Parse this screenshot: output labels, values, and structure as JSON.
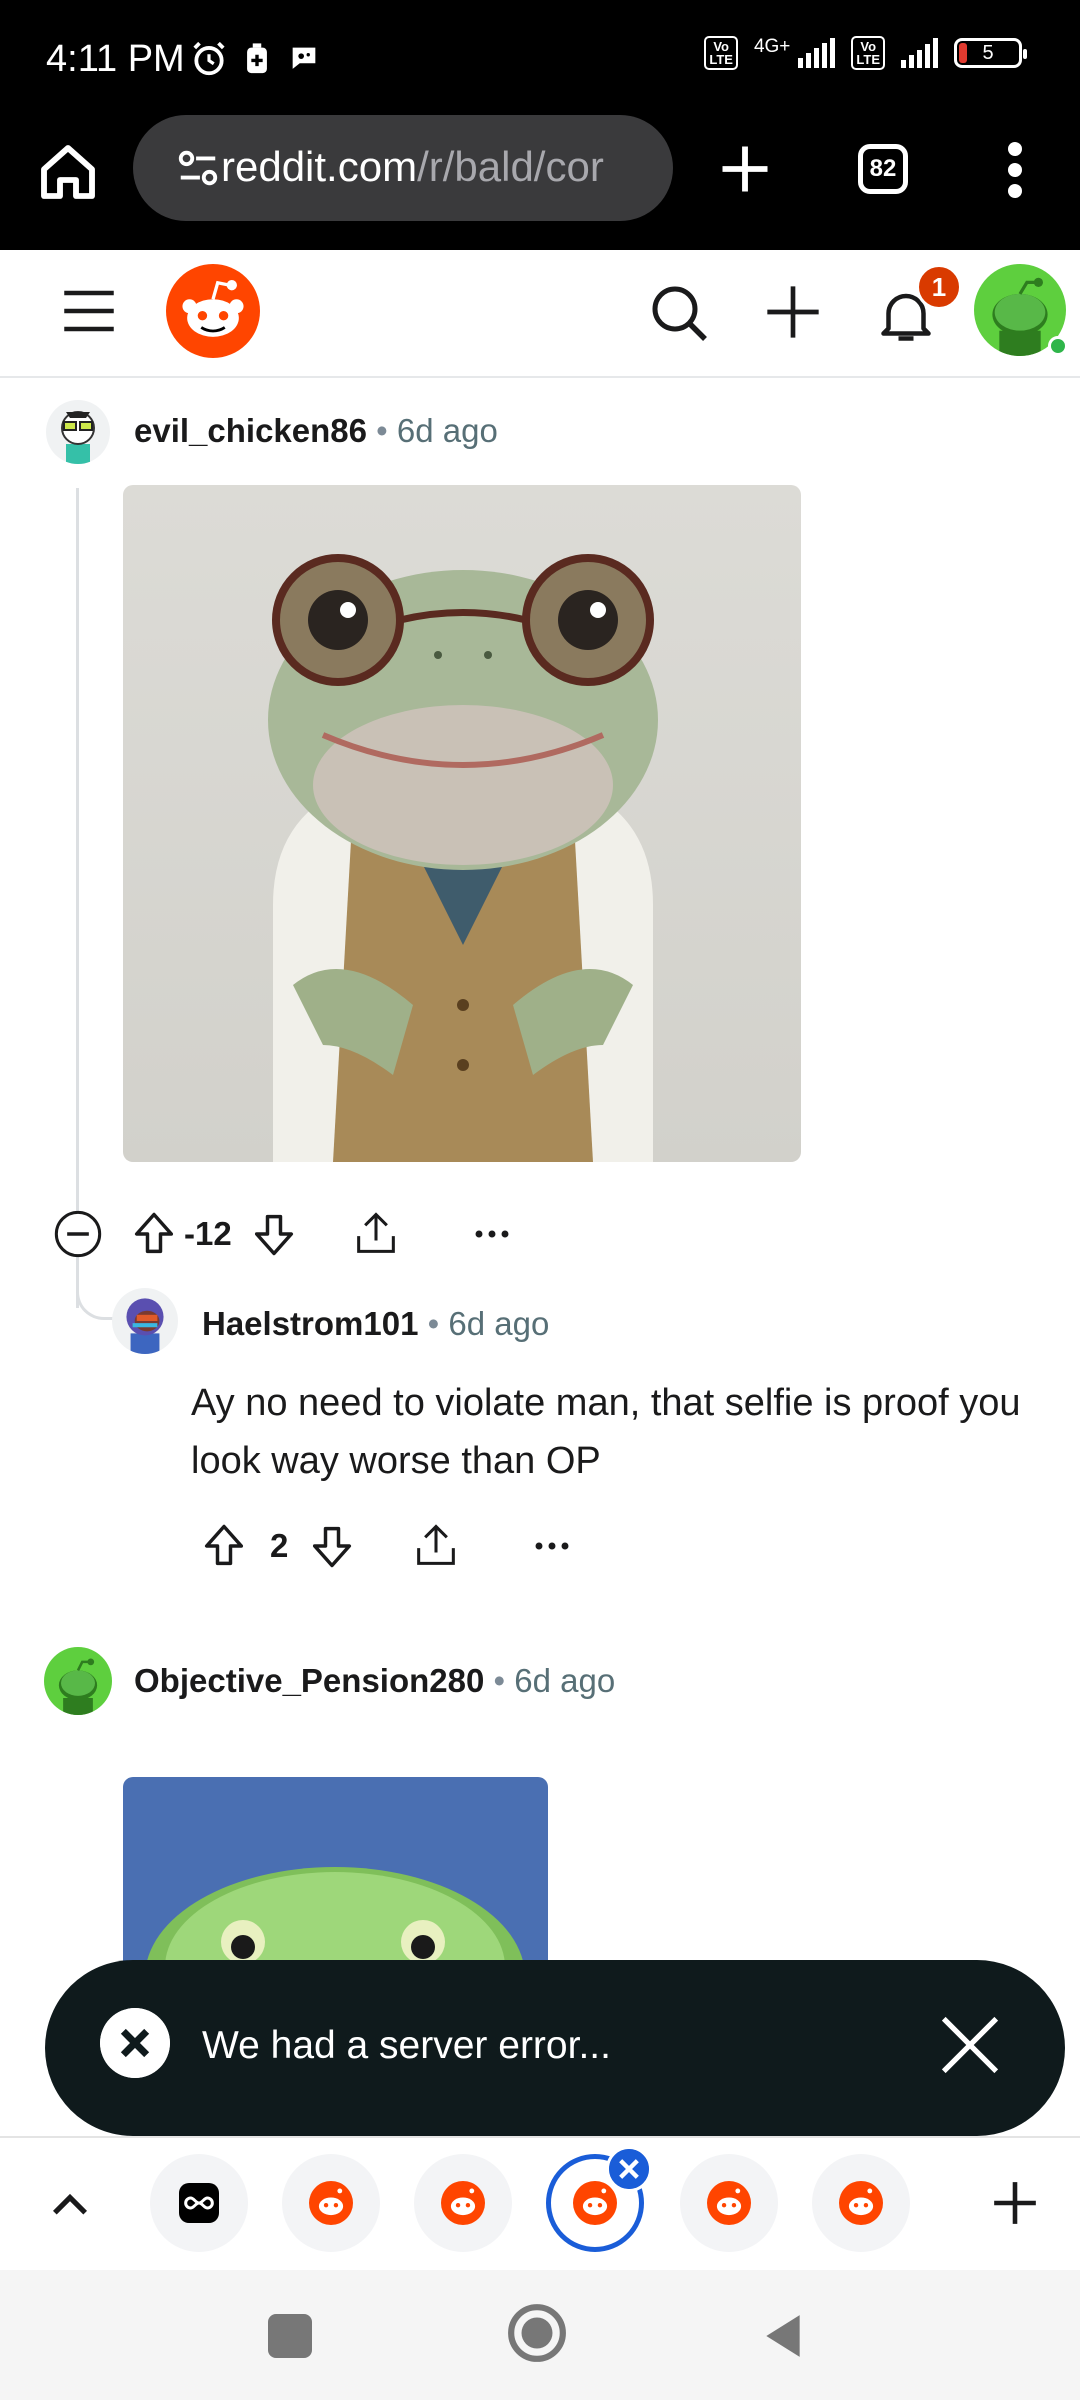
{
  "status_bar": {
    "time": "4:11 PM",
    "network": "4G+",
    "volte_label": "Vo LTE",
    "battery": "5"
  },
  "browser": {
    "url_host": "reddit.com",
    "url_path": "/r/bald/cor",
    "tab_count": "82"
  },
  "header": {
    "notification_count": "1"
  },
  "comments": [
    {
      "username": "evil_chicken86",
      "time": "6d ago",
      "score": "-12",
      "has_image": true,
      "image_desc_icon": "frog-with-glasses-image"
    },
    {
      "username": "Haelstrom101",
      "time": "6d ago",
      "body": "Ay no need to violate man, that selfie is proof you look way worse than OP",
      "score": "2"
    },
    {
      "username": "Objective_Pension280",
      "time": "6d ago",
      "has_image": true
    }
  ],
  "snackbar": {
    "message": "We had a server error..."
  },
  "colors": {
    "reddit_orange": "#ff4500",
    "snackbar_bg": "#0f1a1c",
    "active_tab_blue": "#1a5dd8",
    "badge_red": "#d93a00"
  }
}
